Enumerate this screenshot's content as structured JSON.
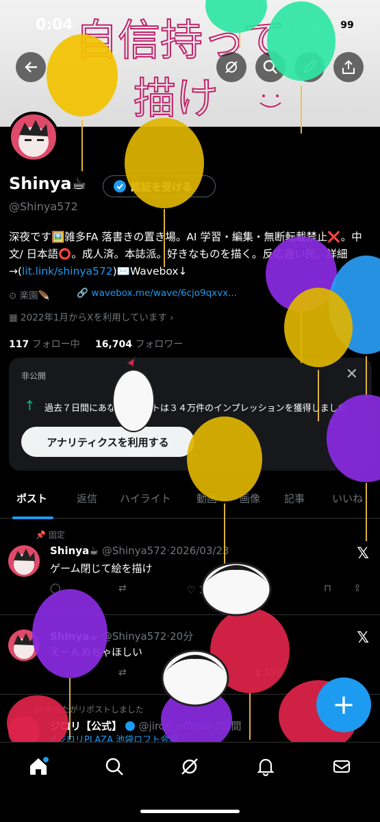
{
  "status_bar": {
    "time": "0:04",
    "battery": "99"
  },
  "banner": {
    "handwriting_line1": "自信持って",
    "handwriting_line2": "描け"
  },
  "profile": {
    "name": "Shinya☕",
    "verify_button": "認証を受ける",
    "handle": "@Shinya572",
    "bio_part1": "深夜です🖼️雑多FA 落書きの置き場。AI 学習・編集・無断転載禁止❌。中文/ 日本語⭕。成人済。本誌派。好きなものを描く。反応遅い民。詳細→(",
    "bio_link": "lit.link/shinya572",
    "bio_part2": ")✉️Wavebox↓",
    "location": "楽園🪶",
    "website": "wavebox.me/wave/6cjo9qxvx...",
    "joined": "2022年1月からXを利用しています",
    "following_count": "117",
    "following_label": "フォロー中",
    "followers_count": "16,704",
    "followers_label": "フォロワー"
  },
  "analytics_card": {
    "private_label": "非公開",
    "impressions_text": "過去７日間にあなたのポストは３４万件のインプレッションを獲得しました",
    "button": "アナリティクスを利用する"
  },
  "tabs": [
    "ポスト",
    "返信",
    "ハイライト",
    "動画",
    "画像",
    "記事",
    "いいね"
  ],
  "posts": [
    {
      "pinned_label": "固定",
      "name": "Shinya☕",
      "handle": "@Shinya572",
      "time": "2026/03/23",
      "text": "ゲーム閉じて絵を描け",
      "likes": "1万"
    },
    {
      "name": "Shinya☕",
      "handle": "@Shinya572",
      "time": "20分",
      "text": "えーんめちゃほしい",
      "views": "159"
    },
    {
      "repost_label": "あなたがリポストしました",
      "name": "ジロリ【公式】",
      "handle": "@jirori_official",
      "time": "2時間",
      "text": "#ジロリPLAZA 池袋ロフト会場"
    }
  ],
  "fab": "+",
  "colors": {
    "accent": "#1d9bf0",
    "balloon_yellow": "#f2c200",
    "balloon_purple": "#8a2be2",
    "balloon_blue": "#2a9df4",
    "balloon_green": "#2fe6a6",
    "balloon_red": "#e0244a"
  }
}
